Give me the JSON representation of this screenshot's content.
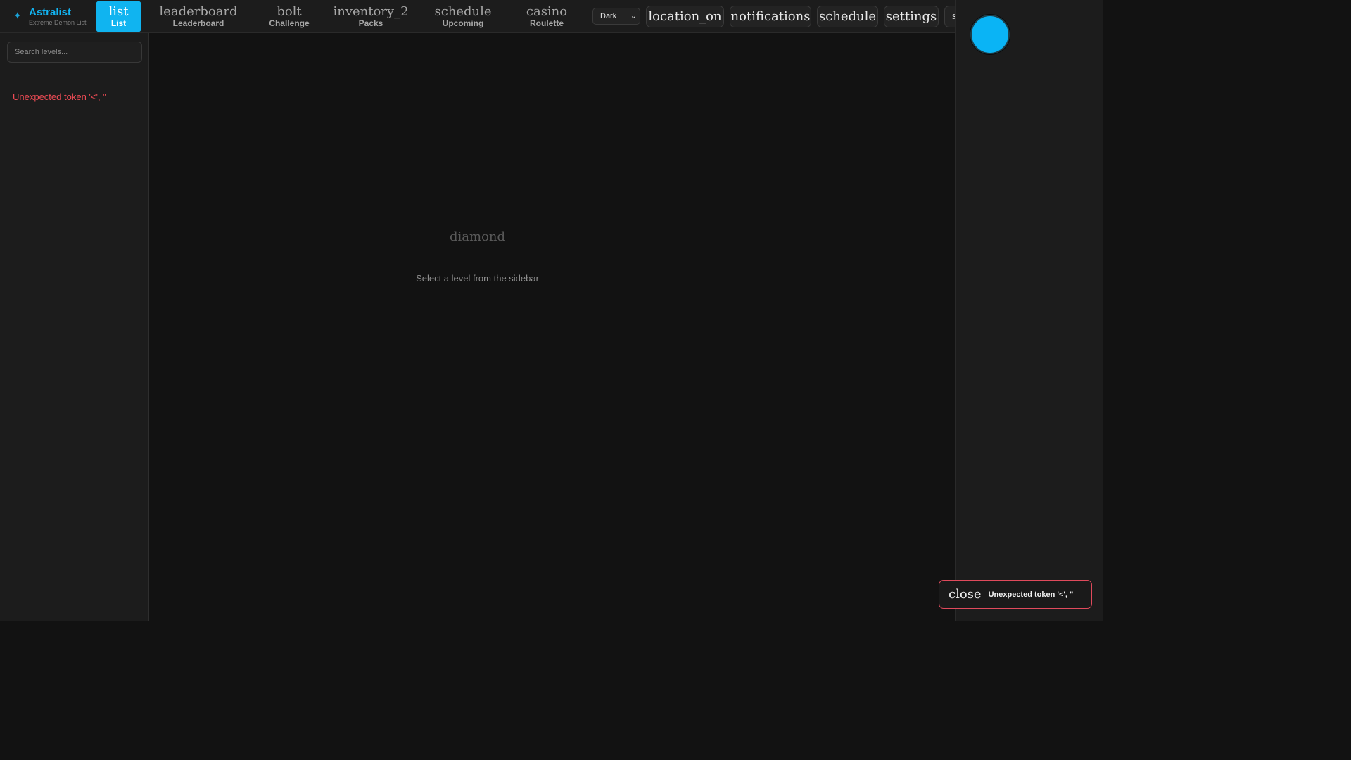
{
  "brand": {
    "name": "Astralist",
    "subtitle": "Extreme Demon List",
    "star_icon": "✦",
    "accent_color": "#12b4f2"
  },
  "nav": {
    "tabs": [
      {
        "icon": "list",
        "label": "List",
        "active": true
      },
      {
        "icon": "leaderboard",
        "label": "Leaderboard",
        "active": false
      },
      {
        "icon": "bolt",
        "label": "Challenge",
        "active": false
      },
      {
        "icon": "inventory_2",
        "label": "Packs",
        "active": false
      },
      {
        "icon": "schedule",
        "label": "Upcoming",
        "active": false
      },
      {
        "icon": "casino",
        "label": "Roulette",
        "active": false
      }
    ]
  },
  "toolbar": {
    "theme_value": "Dark",
    "buttons": [
      "location_on",
      "notifications",
      "schedule",
      "settings",
      "s"
    ]
  },
  "sidebar": {
    "search_placeholder": "Search levels...",
    "error_text": "Unexpected token '<', \""
  },
  "main": {
    "empty_icon": "diamond",
    "empty_text": "Select a level from the sidebar"
  },
  "toast": {
    "close_label": "close",
    "message": "Unexpected token '<', \"",
    "border_color": "#e04a5c"
  }
}
